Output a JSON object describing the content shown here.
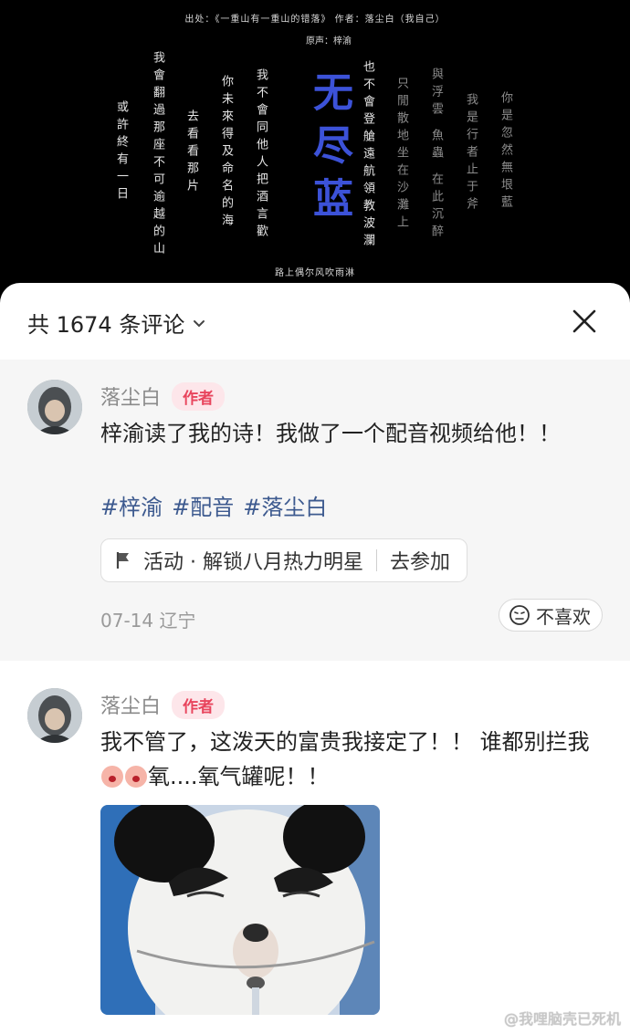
{
  "video": {
    "source_line": "出处：《一重山有一重山的错落》 作者：落尘白（我自己）",
    "voice_line": "原声：梓渝",
    "title": "无尽蓝",
    "bottom_line": "路上偶尔风吹雨淋",
    "poem_lines": [
      "或許終有一日",
      "我會翻過那座不可逾越的山",
      "去看看那片",
      "你未來得及命名的海",
      "我不會同他人把酒言歡",
      "也不會登艙遠航領教波瀾",
      "只閒散地坐在沙灘上",
      "與浮雲 魚蟲 在此沉醉",
      "我是行者止于斧",
      "你是忽然無垠藍"
    ]
  },
  "sheet": {
    "comment_count_label": "共 1674 条评论",
    "close_icon": "close-icon",
    "chevron_icon": "chevron-down-icon"
  },
  "comments": [
    {
      "username": "落尘白",
      "badge": "作者",
      "text": "梓渝读了我的诗！我做了一个配音视频给他！！",
      "tags": [
        "#梓渝",
        "#配音",
        "#落尘白"
      ],
      "activity_label": "活动 · 解锁八月热力明星",
      "activity_action": "去参加",
      "meta": "07-14 辽宁",
      "dislike_label": "不喜欢"
    },
    {
      "username": "落尘白",
      "badge": "作者",
      "text_part1": "我不管了，这泼天的富贵我接定了！！ 谁都别拦我",
      "text_part2": "氧....氧气罐呢！！"
    }
  ],
  "watermark": "@我哩脑壳已死机",
  "colors": {
    "title_blue": "#3c52d8",
    "author_badge": "#e8455d",
    "tag_blue": "#3d5a8f"
  }
}
